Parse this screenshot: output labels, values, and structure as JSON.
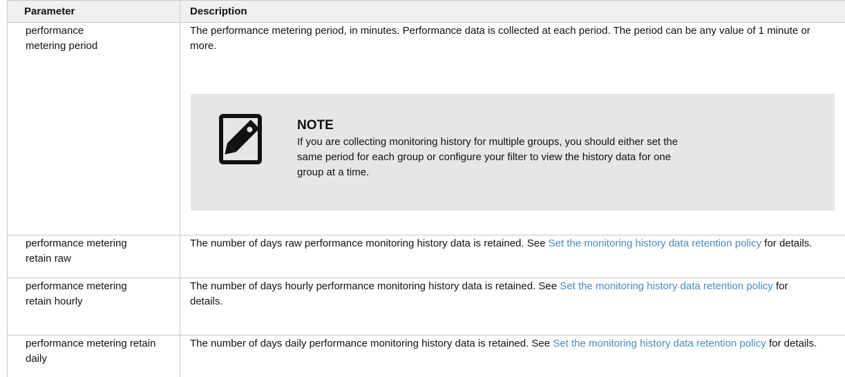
{
  "headers": {
    "parameter": "Parameter",
    "description": "Description"
  },
  "rows": [
    {
      "parameter": "performance metering period",
      "description": "The performance metering period, in minutes. Performance data is collected at each period. The period can be any value of 1 minute or more.",
      "note": {
        "icon": "note-pencil-icon",
        "title": "NOTE",
        "text": "If you are collecting monitoring history for multiple groups, you should either set the same period for each group or configure your filter to view the history data for one group at a time."
      }
    },
    {
      "parameter": "performance metering retain raw",
      "description_before": "The number of days raw performance monitoring history data is retained. See ",
      "link": "Set the monitoring history data retention policy",
      "description_after": " for details."
    },
    {
      "parameter": "performance metering retain hourly",
      "description_before": "The number of days hourly performance monitoring history data is retained. See ",
      "link": "Set the monitoring history data retention policy",
      "description_after": " for details."
    },
    {
      "parameter": "performance metering retain daily",
      "description_before": "The number of days daily performance monitoring history data is retained. See ",
      "link": "Set the monitoring history data retention policy",
      "description_after": " for details."
    }
  ],
  "colors": {
    "link": "#4a8ac4",
    "header_bg": "#f0f0f0",
    "note_bg": "#e6e6e6",
    "border": "#c8c8c8"
  }
}
